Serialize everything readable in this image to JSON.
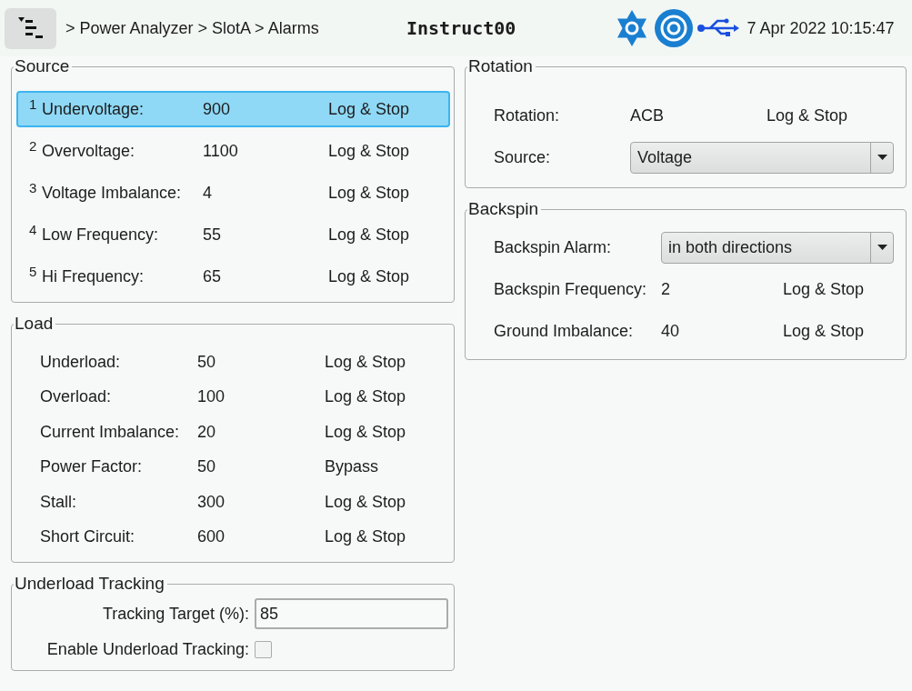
{
  "header": {
    "breadcrumb": "> Power Analyzer > SlotA > Alarms",
    "title": "Instruct00",
    "datetime": "7 Apr 2022 10:15:47"
  },
  "source": {
    "title": "Source",
    "rows": [
      {
        "number": "1",
        "label": "Undervoltage:",
        "value": "900",
        "action": "Log & Stop",
        "selected": true
      },
      {
        "number": "2",
        "label": "Overvoltage:",
        "value": "1100",
        "action": "Log & Stop",
        "selected": false
      },
      {
        "number": "3",
        "label": "Voltage Imbalance:",
        "value": "4",
        "action": "Log & Stop",
        "selected": false
      },
      {
        "number": "4",
        "label": "Low Frequency:",
        "value": "55",
        "action": "Log & Stop",
        "selected": false
      },
      {
        "number": "5",
        "label": "Hi Frequency:",
        "value": "65",
        "action": "Log & Stop",
        "selected": false
      }
    ]
  },
  "load": {
    "title": "Load",
    "rows": [
      {
        "label": "Underload:",
        "value": "50",
        "action": "Log & Stop"
      },
      {
        "label": "Overload:",
        "value": "100",
        "action": "Log & Stop"
      },
      {
        "label": "Current Imbalance:",
        "value": "20",
        "action": "Log & Stop"
      },
      {
        "label": "Power Factor:",
        "value": "50",
        "action": "Bypass"
      },
      {
        "label": "Stall:",
        "value": "300",
        "action": "Log & Stop"
      },
      {
        "label": "Short Circuit:",
        "value": "600",
        "action": "Log & Stop"
      }
    ]
  },
  "underload_tracking": {
    "title": "Underload Tracking",
    "target_label": "Tracking Target (%):",
    "target_value": "85",
    "enable_label": "Enable Underload Tracking:",
    "checked": false
  },
  "rotation": {
    "title": "Rotation",
    "rows": [
      {
        "kind": "text",
        "label": "Rotation:",
        "value": "ACB",
        "action": "Log & Stop"
      },
      {
        "kind": "select",
        "label": "Source:",
        "value": "Voltage"
      }
    ]
  },
  "backspin": {
    "title": "Backspin",
    "rows": [
      {
        "kind": "select",
        "label": "Backspin Alarm:",
        "value": "in both directions"
      },
      {
        "kind": "text",
        "label": "Backspin Frequency:",
        "value": "2",
        "action": "Log & Stop"
      },
      {
        "kind": "text",
        "label": "Ground Imbalance:",
        "value": "40",
        "action": "Log & Stop"
      }
    ]
  }
}
